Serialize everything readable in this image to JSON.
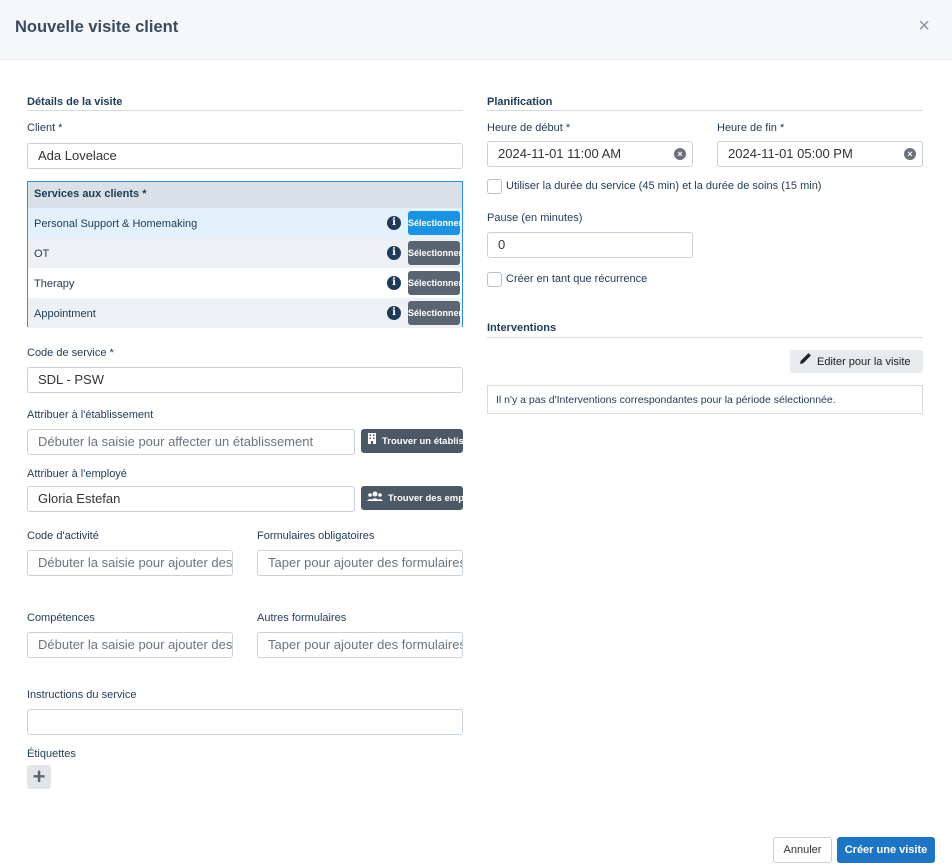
{
  "dialog": {
    "title": "Nouvelle visite client",
    "close_icon": "×"
  },
  "details": {
    "section_title": "Détails de la visite",
    "client_label": "Client *",
    "client_value": "Ada Lovelace",
    "services_header": "Services aux clients *",
    "services": [
      {
        "name": "Personal Support & Homemaking",
        "button": "Sélectionner",
        "selected": true
      },
      {
        "name": "OT",
        "button": "Sélectionner",
        "selected": false
      },
      {
        "name": "Therapy",
        "button": "Sélectionner",
        "selected": false
      },
      {
        "name": "Appointment",
        "button": "Sélectionner",
        "selected": false
      }
    ],
    "service_code_label": "Code de service *",
    "service_code_value": "SDL - PSW",
    "facility_label": "Attribuer à l'établissement",
    "facility_placeholder": "Débuter la saisie pour affecter un établissement",
    "facility_button": "Trouver un établissement",
    "employee_label": "Attribuer à l'employé",
    "employee_value": "Gloria Estefan",
    "employee_button": "Trouver des employés",
    "activity_code_label": "Code d'activité",
    "activity_code_placeholder": "Débuter la saisie pour ajouter des codes",
    "required_forms_label": "Formulaires obligatoires",
    "required_forms_placeholder": "Taper pour ajouter des formulaires",
    "skills_label": "Compétences",
    "skills_placeholder": "Débuter la saisie pour ajouter des compétences",
    "other_forms_label": "Autres formulaires",
    "other_forms_placeholder": "Taper pour ajouter des formulaires",
    "instructions_label": "Instructions du service",
    "instructions_value": "",
    "tags_label": "Étiquettes",
    "add_tag_icon": "+"
  },
  "planning": {
    "section_title": "Planification",
    "start_label": "Heure de début *",
    "start_value": "2024-11-01 11:00 AM",
    "end_label": "Heure de fin *",
    "end_value": "2024-11-01 05:00 PM",
    "use_duration_label": "Utiliser la durée du service (45 min) et la durée de soins (15 min)",
    "use_duration_checked": false,
    "pause_label": "Pause (en minutes)",
    "pause_value": "0",
    "recurrence_label": "Créer en tant que récurrence",
    "recurrence_checked": false
  },
  "interventions": {
    "section_title": "Interventions",
    "edit_button": "Editer pour la visite",
    "empty_message": "Il n'y a pas d'Interventions correspondantes pour la période sélectionnée."
  },
  "footer": {
    "cancel_label": "Annuler",
    "create_label": "Créer une visite"
  },
  "icons": {
    "info": "info-icon",
    "building": "building-icon",
    "users": "users-icon",
    "pencil": "pencil-icon",
    "clear": "clear-icon"
  },
  "colors": {
    "primary": "#1e75c4",
    "selected_button": "#1a94e0",
    "dark_button": "#4d5866",
    "text": "#1f3a57"
  }
}
